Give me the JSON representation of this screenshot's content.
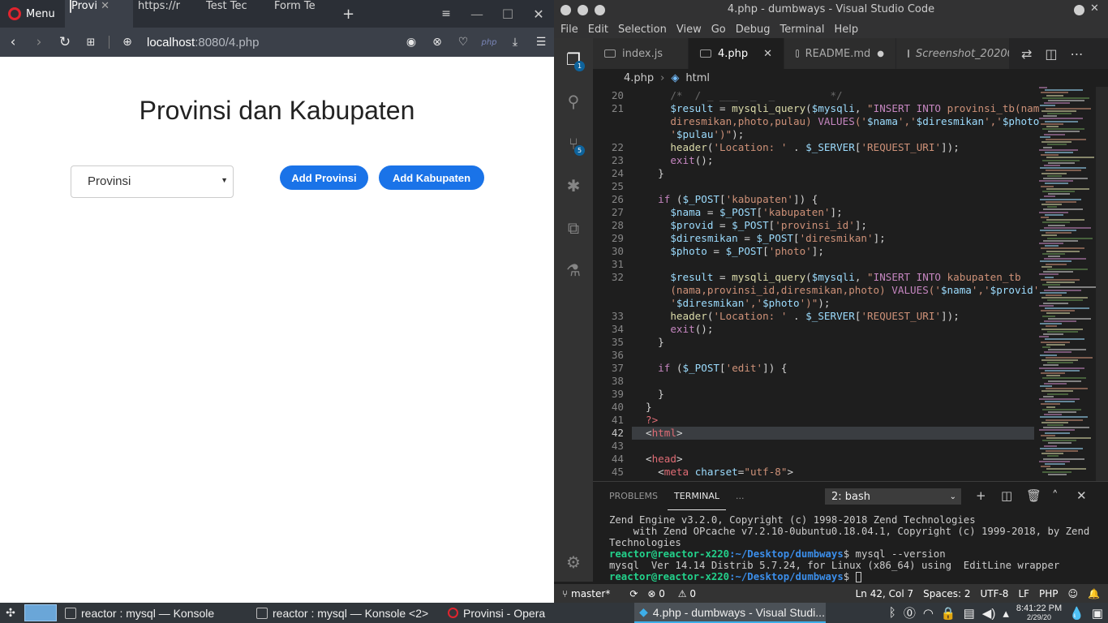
{
  "opera": {
    "menu_label": "Menu",
    "tabs": [
      {
        "label": "Provi",
        "active": true
      },
      {
        "label": "https://r",
        "active": false
      },
      {
        "label": "Test Tec",
        "active": false
      },
      {
        "label": "Form Te",
        "active": false
      }
    ],
    "new_tab": "+",
    "url_host": "localhost",
    "url_rest": ":8080/4.php",
    "page": {
      "title": "Provinsi dan Kabupaten",
      "select_value": "Provinsi",
      "btn_add_provinsi": "Add Provinsi",
      "btn_add_kabupaten": "Add Kabupaten"
    }
  },
  "vscode": {
    "window_title": "4.php - dumbways - Visual Studio Code",
    "menu": [
      "File",
      "Edit",
      "Selection",
      "View",
      "Go",
      "Debug",
      "Terminal",
      "Help"
    ],
    "tabs": [
      {
        "label": "index.js",
        "active": false
      },
      {
        "label": "4.php",
        "active": true
      },
      {
        "label": "README.md",
        "active": false
      },
      {
        "label": "Screenshot_202002...",
        "active": false
      }
    ],
    "breadcrumb": [
      "4.php",
      "html"
    ],
    "line_numbers": [
      "20",
      "21",
      "",
      "",
      "22",
      "23",
      "24",
      "25",
      "26",
      "27",
      "28",
      "29",
      "30",
      "31",
      "32",
      "",
      "",
      "33",
      "34",
      "35",
      "36",
      "37",
      "38",
      "39",
      "40",
      "41",
      "42",
      "43",
      "44",
      "45"
    ],
    "panel": {
      "tabs": [
        "PROBLEMS",
        "TERMINAL",
        "..."
      ],
      "terminal_select": "2: bash",
      "lines": [
        "Zend Engine v3.2.0, Copyright (c) 1998-2018 Zend Technologies",
        "    with Zend OPcache v7.2.10-0ubuntu0.18.04.1, Copyright (c) 1999-2018, by Zend",
        "Technologies"
      ],
      "prompt_user": "reactor@reactor-x220",
      "prompt_path": ":~/Desktop/dumbways",
      "command": "$ mysql --version",
      "output": "mysql  Ver 14.14 Distrib 5.7.24, for Linux (x86_64) using  EditLine wrapper",
      "prompt2_end": "$ "
    },
    "status": {
      "branch": "master*",
      "errors": "0",
      "warnings": "0",
      "position": "Ln 42, Col 7",
      "spaces": "Spaces: 2",
      "encoding": "UTF-8",
      "eol": "LF",
      "language": "PHP"
    },
    "badges": {
      "explorer": "1",
      "scm": "5"
    }
  },
  "taskbar": {
    "items": [
      "reactor : mysql — Konsole",
      "reactor : mysql — Konsole <2>",
      "Provinsi - Opera",
      "4.php - dumbways - Visual Studi..."
    ],
    "clock_time": "8:41:22 PM",
    "clock_date": "2/29/20"
  },
  "colors": {
    "accent": "#1a73e8",
    "vs_blue": "#0e639c",
    "opera_red": "#e0242e"
  }
}
